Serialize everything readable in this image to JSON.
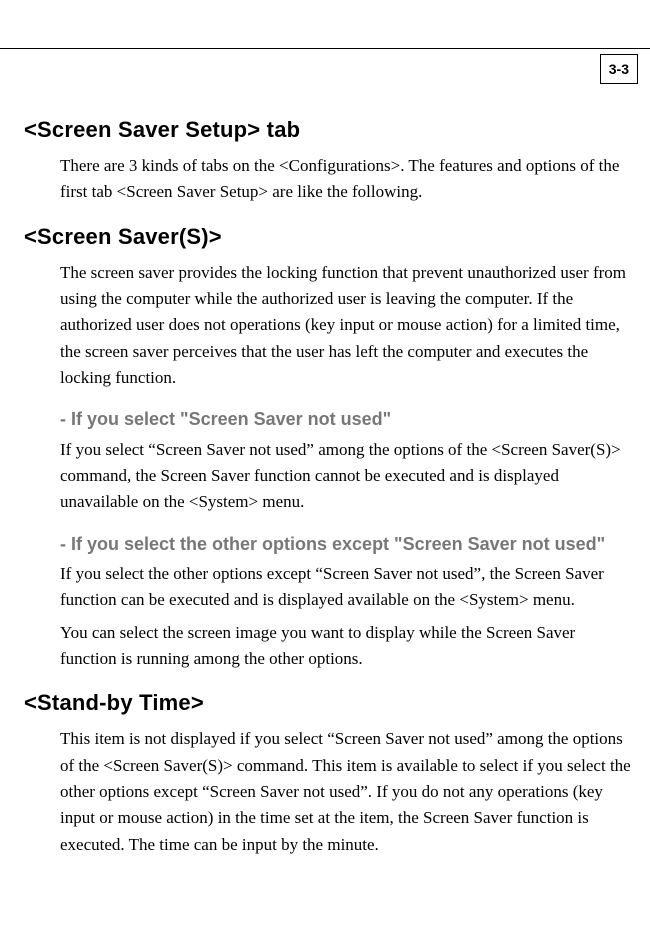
{
  "page_number": "3-3",
  "sections": {
    "screen_saver_setup": {
      "title": "<Screen Saver Setup> tab",
      "body": "There are 3 kinds of tabs on the <Configurations>. The features and options of the first tab <Screen Saver Setup> are like the following."
    },
    "screen_saver_s": {
      "title": "<Screen Saver(S)>",
      "body": "The screen saver provides the locking function that prevent unauthorized user from using the computer while the authorized user is leaving the computer. If the authorized user does not operations (key input or mouse action) for a limited time, the screen saver perceives that the user has left the computer and executes the locking function.",
      "sub1_title": "- If you select \"Screen Saver not used\"",
      "sub1_body": "If you select “Screen Saver not used” among the options of the <Screen Saver(S)> command, the Screen Saver function cannot be executed and is displayed unavailable on the <System> menu.",
      "sub2_title": "- If you select the other options except \"Screen Saver not used\"",
      "sub2_body_a": "If you select the other options except “Screen Saver not used”, the Screen Saver function can be executed and is displayed available on the <System> menu.",
      "sub2_body_b": "You can select the screen image you want to display while the Screen Saver function is running among the other options."
    },
    "standby_time": {
      "title": "<Stand-by Time>",
      "body": "This item is not displayed if you select “Screen Saver not used” among the options of the <Screen Saver(S)> command. This item is available to select if you select the other options except “Screen Saver not used”. If you do not any operations (key input or mouse action) in the time set at the item, the Screen Saver function is executed. The time can be input by the minute."
    }
  }
}
